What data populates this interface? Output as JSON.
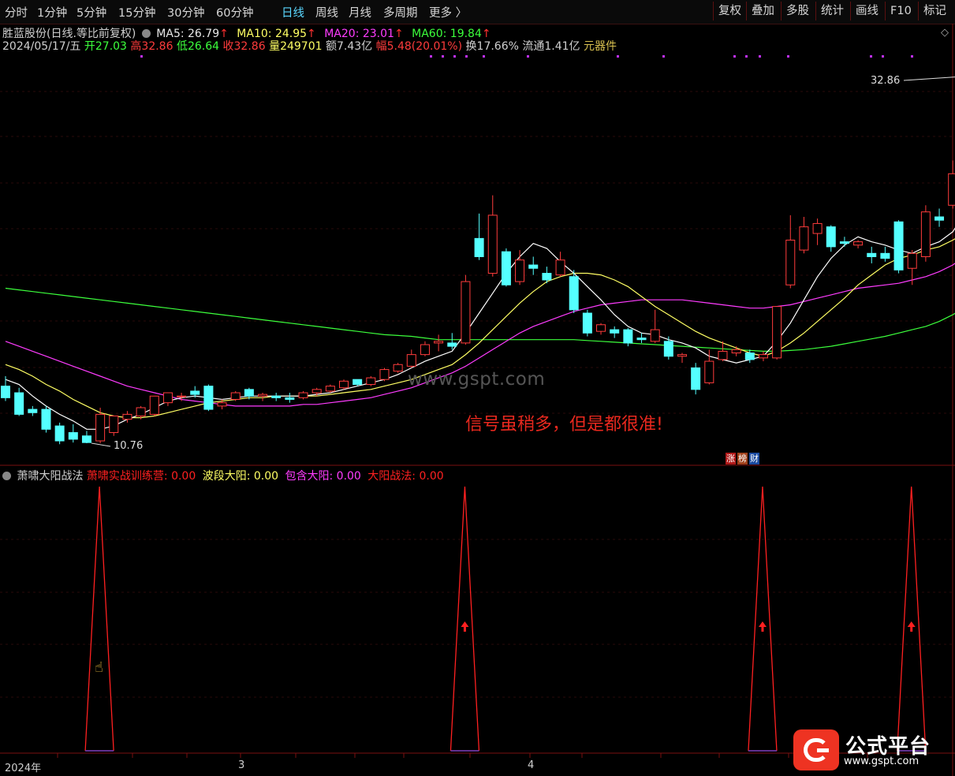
{
  "toolbar": {
    "periods": [
      "分时",
      "1分钟",
      "5分钟",
      "15分钟",
      "30分钟",
      "60分钟",
      "日线",
      "周线",
      "月线",
      "多周期",
      "更多 〉"
    ],
    "active_period": "日线",
    "right_buttons": [
      "复权",
      "叠加",
      "多股",
      "统计",
      "画线",
      "F10",
      "标记"
    ]
  },
  "header": {
    "stock": "胜蓝股份",
    "mode": "(日线.等比前复权)",
    "ma5_label": "MA5:",
    "ma5": "26.79",
    "ma10_label": "MA10:",
    "ma10": "24.95",
    "ma20_label": "MA20:",
    "ma20": "23.01",
    "ma60_label": "MA60:",
    "ma60": "19.84",
    "up_arrow": "↑"
  },
  "quote": {
    "date": "2024/05/17/五",
    "open_label": "开",
    "open": "27.03",
    "high_label": "高",
    "high": "32.86",
    "low_label": "低",
    "low": "26.64",
    "close_label": "收",
    "close": "32.86",
    "vol_label": "量",
    "vol": "249701",
    "amount_label": "额",
    "amount": "7.43亿",
    "range_label": "幅",
    "range": "5.48(20.01%)",
    "turnover_label": "换",
    "turnover": "17.66%",
    "float_label": "流通",
    "float": "1.41亿",
    "sector": "元器件"
  },
  "price_labels": {
    "high": "32.86",
    "low": "10.76"
  },
  "watermark": "www.gspt.com",
  "annotation": "信号虽稍多，但是都很准!",
  "badges": [
    "涨",
    "榜",
    "财"
  ],
  "indicator": {
    "name": "萧啸大阳战法",
    "l1_label": "萧啸实战训练营:",
    "l1": "0.00",
    "l2_label": "波段大阳:",
    "l2": "0.00",
    "l3_label": "包含大阳:",
    "l3": "0.00",
    "l4_label": "大阳战法:",
    "l4": "0.00",
    "signals": [
      {
        "center_bar": 7,
        "arrow": false
      },
      {
        "center_bar": 34,
        "arrow": true
      },
      {
        "center_bar": 56,
        "arrow": true
      },
      {
        "center_bar": 67,
        "arrow": true
      }
    ]
  },
  "axis": {
    "year": "2024年",
    "m3": "3",
    "m4": "4"
  },
  "logo": {
    "name": "公式平台",
    "url": "www.gspt.com"
  },
  "colors": {
    "up": "#ff3c3c",
    "down": "#54ffff",
    "ma5": "#ffffff",
    "ma10": "#ffff64",
    "ma20": "#ff3cff",
    "ma60": "#3cff3c",
    "signal": "#ff2020"
  },
  "chart_data": {
    "type": "candlestick",
    "ylim": [
      10,
      34
    ],
    "bars": [
      {
        "o": 14.2,
        "h": 14.8,
        "c": 13.5,
        "l": 13.3
      },
      {
        "o": 13.8,
        "h": 14.1,
        "c": 12.5,
        "l": 12.4
      },
      {
        "o": 12.8,
        "h": 13.0,
        "c": 12.6,
        "l": 12.4
      },
      {
        "o": 12.8,
        "h": 13.0,
        "c": 11.6,
        "l": 11.4
      },
      {
        "o": 11.8,
        "h": 12.0,
        "c": 10.9,
        "l": 10.7
      },
      {
        "o": 11.4,
        "h": 11.9,
        "c": 11.0,
        "l": 10.8
      },
      {
        "o": 11.2,
        "h": 11.5,
        "c": 10.8,
        "l": 10.76
      },
      {
        "o": 10.9,
        "h": 12.9,
        "c": 12.5,
        "l": 10.76
      },
      {
        "o": 11.4,
        "h": 12.0,
        "c": 12.4,
        "l": 11.2
      },
      {
        "o": 12.2,
        "h": 12.7,
        "c": 12.5,
        "l": 12.0
      },
      {
        "o": 12.4,
        "h": 13.0,
        "c": 12.9,
        "l": 12.2
      },
      {
        "o": 12.5,
        "h": 13.6,
        "c": 13.6,
        "l": 12.4
      },
      {
        "o": 13.2,
        "h": 13.8,
        "c": 13.8,
        "l": 13.0
      },
      {
        "o": 13.6,
        "h": 13.8,
        "c": 13.6,
        "l": 13.3
      },
      {
        "o": 13.9,
        "h": 14.2,
        "c": 13.7,
        "l": 13.5
      },
      {
        "o": 14.2,
        "h": 14.3,
        "c": 12.8,
        "l": 12.7
      },
      {
        "o": 13.0,
        "h": 13.4,
        "c": 13.2,
        "l": 12.8
      },
      {
        "o": 13.4,
        "h": 13.9,
        "c": 13.8,
        "l": 13.3
      },
      {
        "o": 14.0,
        "h": 14.1,
        "c": 13.6,
        "l": 13.4
      },
      {
        "o": 13.6,
        "h": 13.8,
        "c": 13.7,
        "l": 13.3
      },
      {
        "o": 13.6,
        "h": 13.8,
        "c": 13.5,
        "l": 13.3
      },
      {
        "o": 13.5,
        "h": 13.8,
        "c": 13.4,
        "l": 13.2
      },
      {
        "o": 13.5,
        "h": 13.9,
        "c": 13.8,
        "l": 13.4
      },
      {
        "o": 13.8,
        "h": 14.1,
        "c": 14.0,
        "l": 13.6
      },
      {
        "o": 13.9,
        "h": 14.3,
        "c": 14.2,
        "l": 13.8
      },
      {
        "o": 14.1,
        "h": 14.6,
        "c": 14.5,
        "l": 14.0
      },
      {
        "o": 14.6,
        "h": 14.6,
        "c": 14.3,
        "l": 14.2
      },
      {
        "o": 14.3,
        "h": 14.8,
        "c": 14.7,
        "l": 14.2
      },
      {
        "o": 14.6,
        "h": 15.3,
        "c": 15.2,
        "l": 14.5
      },
      {
        "o": 15.1,
        "h": 15.6,
        "c": 15.5,
        "l": 15.0
      },
      {
        "o": 15.4,
        "h": 16.4,
        "c": 16.1,
        "l": 15.3
      },
      {
        "o": 16.1,
        "h": 16.9,
        "c": 16.7,
        "l": 16.0
      },
      {
        "o": 16.8,
        "h": 17.3,
        "c": 16.9,
        "l": 16.3
      },
      {
        "o": 16.8,
        "h": 17.4,
        "c": 16.6,
        "l": 16.4
      },
      {
        "o": 16.8,
        "h": 20.9,
        "c": 20.5,
        "l": 16.7
      },
      {
        "o": 23.1,
        "h": 24.6,
        "c": 22.0,
        "l": 21.8
      },
      {
        "o": 21.0,
        "h": 25.7,
        "c": 24.5,
        "l": 20.8
      },
      {
        "o": 22.3,
        "h": 22.5,
        "c": 20.3,
        "l": 20.2
      },
      {
        "o": 20.5,
        "h": 22.4,
        "c": 21.8,
        "l": 20.3
      },
      {
        "o": 21.5,
        "h": 22.0,
        "c": 21.3,
        "l": 20.9
      },
      {
        "o": 21.0,
        "h": 21.4,
        "c": 20.6,
        "l": 20.4
      },
      {
        "o": 20.9,
        "h": 22.3,
        "c": 21.8,
        "l": 20.8
      },
      {
        "o": 20.8,
        "h": 21.2,
        "c": 18.8,
        "l": 18.6
      },
      {
        "o": 18.6,
        "h": 18.8,
        "c": 17.4,
        "l": 17.2
      },
      {
        "o": 17.5,
        "h": 18.0,
        "c": 17.9,
        "l": 17.3
      },
      {
        "o": 17.6,
        "h": 17.8,
        "c": 17.4,
        "l": 17.1
      },
      {
        "o": 17.6,
        "h": 17.7,
        "c": 16.8,
        "l": 16.6
      },
      {
        "o": 17.1,
        "h": 17.4,
        "c": 17.0,
        "l": 16.8
      },
      {
        "o": 16.9,
        "h": 18.8,
        "c": 17.6,
        "l": 16.8
      },
      {
        "o": 16.9,
        "h": 17.2,
        "c": 16.0,
        "l": 15.8
      },
      {
        "o": 16.0,
        "h": 16.2,
        "c": 16.1,
        "l": 15.6
      },
      {
        "o": 15.3,
        "h": 15.6,
        "c": 14.0,
        "l": 13.7
      },
      {
        "o": 14.4,
        "h": 16.4,
        "c": 15.7,
        "l": 14.3
      },
      {
        "o": 15.8,
        "h": 16.9,
        "c": 16.3,
        "l": 15.7
      },
      {
        "o": 16.2,
        "h": 16.6,
        "c": 16.4,
        "l": 16.0
      },
      {
        "o": 16.2,
        "h": 16.4,
        "c": 15.8,
        "l": 15.6
      },
      {
        "o": 15.9,
        "h": 16.3,
        "c": 16.1,
        "l": 15.7
      },
      {
        "o": 15.9,
        "h": 19.0,
        "c": 19.0,
        "l": 15.8
      },
      {
        "o": 20.3,
        "h": 24.5,
        "c": 23.0,
        "l": 20.1
      },
      {
        "o": 22.4,
        "h": 24.4,
        "c": 23.8,
        "l": 22.2
      },
      {
        "o": 23.4,
        "h": 24.3,
        "c": 24.0,
        "l": 22.7
      },
      {
        "o": 23.8,
        "h": 23.9,
        "c": 22.6,
        "l": 22.3
      },
      {
        "o": 22.9,
        "h": 23.2,
        "c": 22.8,
        "l": 22.6
      },
      {
        "o": 22.7,
        "h": 23.0,
        "c": 22.9,
        "l": 22.5
      },
      {
        "o": 22.2,
        "h": 22.6,
        "c": 22.0,
        "l": 21.6
      },
      {
        "o": 22.2,
        "h": 22.6,
        "c": 21.9,
        "l": 21.7
      },
      {
        "o": 24.1,
        "h": 24.2,
        "c": 21.2,
        "l": 21.0
      },
      {
        "o": 21.3,
        "h": 22.4,
        "c": 22.2,
        "l": 20.3
      },
      {
        "o": 22.0,
        "h": 25.1,
        "c": 24.7,
        "l": 21.7
      },
      {
        "o": 24.4,
        "h": 24.9,
        "c": 24.2,
        "l": 23.8
      },
      {
        "o": 25.1,
        "h": 27.8,
        "c": 27.0,
        "l": 24.9
      },
      {
        "o": 27.03,
        "h": 32.86,
        "c": 32.86,
        "l": 26.64
      }
    ],
    "ma5": [
      14.6,
      14.3,
      13.6,
      13.0,
      12.5,
      12.1,
      11.6,
      11.6,
      11.8,
      12.2,
      12.5,
      12.9,
      13.3,
      13.5,
      13.6,
      13.5,
      13.4,
      13.5,
      13.6,
      13.6,
      13.6,
      13.6,
      13.6,
      13.7,
      13.8,
      14.0,
      14.2,
      14.4,
      14.6,
      14.9,
      15.3,
      15.7,
      16.0,
      16.3,
      17.4,
      18.6,
      19.8,
      21.0,
      22.0,
      22.8,
      22.5,
      21.7,
      21.0,
      20.2,
      19.4,
      18.5,
      17.8,
      17.4,
      17.3,
      17.0,
      16.8,
      16.5,
      16.0,
      15.8,
      15.6,
      15.8,
      16.0,
      16.9,
      18.0,
      19.4,
      20.8,
      21.9,
      22.7,
      23.2,
      22.9,
      22.7,
      22.4,
      22.2,
      22.6,
      22.9,
      23.5,
      24.8,
      26.5
    ],
    "ma10": [
      15.5,
      15.2,
      14.8,
      14.3,
      13.9,
      13.4,
      13.0,
      12.6,
      12.4,
      12.3,
      12.3,
      12.4,
      12.6,
      12.8,
      13.0,
      13.2,
      13.3,
      13.4,
      13.5,
      13.5,
      13.6,
      13.6,
      13.6,
      13.6,
      13.7,
      13.8,
      13.9,
      14.0,
      14.2,
      14.4,
      14.6,
      14.9,
      15.2,
      15.5,
      16.1,
      16.8,
      17.6,
      18.4,
      19.2,
      19.9,
      20.5,
      20.8,
      21.0,
      21.0,
      20.9,
      20.6,
      20.2,
      19.6,
      19.0,
      18.5,
      18.0,
      17.5,
      17.1,
      16.8,
      16.5,
      16.2,
      16.0,
      16.3,
      16.8,
      17.4,
      18.1,
      18.8,
      19.5,
      20.3,
      20.9,
      21.5,
      21.9,
      22.1,
      22.4,
      22.6,
      23.0,
      23.5,
      24.2
    ],
    "ma20": [
      16.9,
      16.6,
      16.3,
      16.0,
      15.7,
      15.4,
      15.1,
      14.8,
      14.5,
      14.2,
      14.0,
      13.8,
      13.6,
      13.4,
      13.3,
      13.2,
      13.1,
      13.0,
      13.0,
      13.0,
      13.0,
      13.0,
      13.1,
      13.1,
      13.2,
      13.3,
      13.4,
      13.5,
      13.7,
      13.9,
      14.1,
      14.4,
      14.7,
      15.0,
      15.4,
      15.9,
      16.4,
      16.9,
      17.4,
      17.8,
      18.1,
      18.4,
      18.7,
      18.9,
      19.1,
      19.2,
      19.3,
      19.4,
      19.4,
      19.4,
      19.4,
      19.3,
      19.2,
      19.1,
      19.0,
      18.9,
      18.9,
      19.0,
      19.1,
      19.3,
      19.5,
      19.7,
      19.9,
      20.1,
      20.2,
      20.3,
      20.4,
      20.6,
      20.8,
      21.1,
      21.5,
      22.1,
      23.0
    ],
    "ma60": [
      20.1,
      20.0,
      19.9,
      19.8,
      19.7,
      19.6,
      19.5,
      19.4,
      19.3,
      19.2,
      19.1,
      19.0,
      18.9,
      18.8,
      18.7,
      18.6,
      18.5,
      18.4,
      18.3,
      18.2,
      18.1,
      18.0,
      17.9,
      17.8,
      17.7,
      17.6,
      17.5,
      17.4,
      17.3,
      17.25,
      17.2,
      17.1,
      17.0,
      17.0,
      17.0,
      17.0,
      17.0,
      17.0,
      17.0,
      17.0,
      17.0,
      17.0,
      17.0,
      16.95,
      16.9,
      16.85,
      16.8,
      16.75,
      16.7,
      16.65,
      16.6,
      16.55,
      16.5,
      16.45,
      16.4,
      16.35,
      16.3,
      16.3,
      16.35,
      16.4,
      16.5,
      16.6,
      16.75,
      16.9,
      17.05,
      17.2,
      17.4,
      17.6,
      17.8,
      18.1,
      18.5,
      19.0,
      19.84
    ]
  }
}
